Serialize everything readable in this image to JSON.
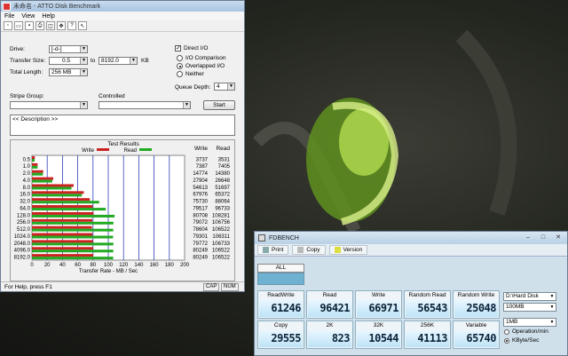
{
  "atto": {
    "title": "未命名 - ATTO Disk Benchmark",
    "menu": [
      "File",
      "View",
      "Help"
    ],
    "labels": {
      "drive": "Drive:",
      "transfer_size": "Transfer Size:",
      "to": "to",
      "kb": "KB",
      "total_length": "Total Length:",
      "stripe_group": "Stripe Group:",
      "controlled": "Controlled",
      "direct_io": "Direct I/O",
      "io_comparison": "I/O Comparison",
      "overlapped_io": "Overlapped I/O",
      "neither": "Neither",
      "queue_depth": "Queue Depth:",
      "start": "Start",
      "test_results": "Test Results",
      "write": "Write",
      "read": "Read",
      "col_write": "Write",
      "col_read": "Read"
    },
    "values": {
      "drive": "[-d-]",
      "transfer_from": "0.5",
      "transfer_to": "8192.0",
      "total_length": "256 MB",
      "queue_depth": "4",
      "description": "<< Description >>"
    },
    "status": "For Help, press F1",
    "indicators": [
      "CAP",
      "NUM"
    ]
  },
  "chart_data": {
    "type": "bar",
    "orientation": "horizontal",
    "title": "Test Results",
    "xlabel": "Transfer Rate - MB / Sec",
    "xlim": [
      0,
      200
    ],
    "xticks": [
      "0",
      "20",
      "40",
      "60",
      "80",
      "100",
      "120",
      "140",
      "160",
      "180",
      "200"
    ],
    "categories": [
      "0.5",
      "1.0",
      "2.0",
      "4.0",
      "8.0",
      "16.0",
      "32.0",
      "64.0",
      "128.0",
      "256.0",
      "512.0",
      "1024.0",
      "2048.0",
      "4096.0",
      "8192.0"
    ],
    "series": [
      {
        "name": "Write",
        "color": "#cc2222",
        "values": [
          3737,
          7387,
          14774,
          27904,
          54613,
          67976,
          75730,
          79517,
          80708,
          79072,
          78604,
          79301,
          79772,
          80249,
          80249
        ]
      },
      {
        "name": "Read",
        "color": "#22aa22",
        "values": [
          3531,
          7405,
          14380,
          26648,
          51697,
          65372,
          88064,
          96733,
          108281,
          106756,
          106522,
          106311,
          106733,
          106522,
          106522
        ]
      }
    ],
    "value_units": "KB/sec",
    "grid": true
  },
  "fdbench": {
    "title": "FDBENCH",
    "toolbar": [
      "Print",
      "Copy",
      "Version"
    ],
    "tab": "ALL",
    "cells": [
      {
        "label": "ReadWrite",
        "value": "61246"
      },
      {
        "label": "Read",
        "value": "96421"
      },
      {
        "label": "Write",
        "value": "66971"
      },
      {
        "label": "Random Read",
        "value": "56543"
      },
      {
        "label": "Random Write",
        "value": "25048"
      },
      {
        "label": "Copy",
        "value": "29555"
      },
      {
        "label": "2K",
        "value": "823"
      },
      {
        "label": "32K",
        "value": "10544"
      },
      {
        "label": "256K",
        "value": "41113"
      },
      {
        "label": "Variable",
        "value": "65740"
      }
    ],
    "drive_select": "D:\\Hard Disk",
    "size_select": "100MB",
    "block_select": "1MB",
    "unit_options": [
      "Operation/min",
      "KByte/Sec"
    ],
    "unit_selected": "KByte/Sec"
  }
}
